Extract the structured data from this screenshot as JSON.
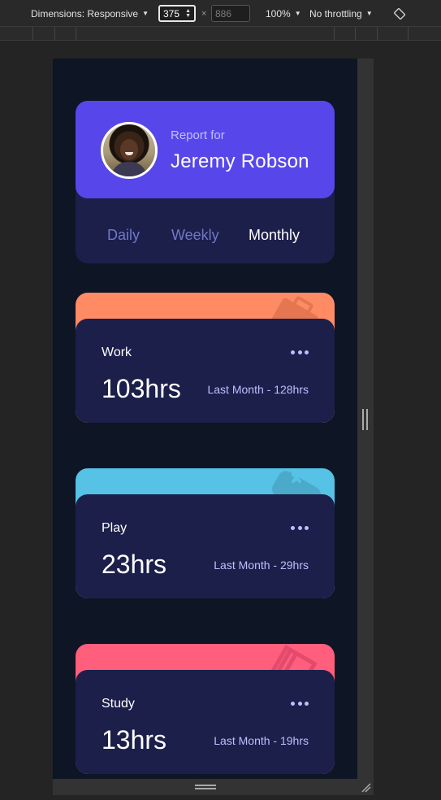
{
  "devtools": {
    "dimensions_label": "Dimensions: Responsive",
    "width_value": "375",
    "times": "×",
    "height_placeholder": "886",
    "zoom_label": "100%",
    "throttle_label": "No throttling"
  },
  "profile": {
    "report_for": "Report for",
    "name": "Jeremy Robson",
    "tabs": [
      {
        "label": "Daily",
        "active": false
      },
      {
        "label": "Weekly",
        "active": false
      },
      {
        "label": "Monthly",
        "active": true
      }
    ]
  },
  "activities": [
    {
      "title": "Work",
      "hours": "103hrs",
      "previous": "Last Month - 128hrs",
      "color": "#ff8b64",
      "icon": "work-briefcase-icon"
    },
    {
      "title": "Play",
      "hours": "23hrs",
      "previous": "Last Month - 29hrs",
      "color": "#55c2e6",
      "icon": "play-gamepad-icon"
    },
    {
      "title": "Study",
      "hours": "13hrs",
      "previous": "Last Month - 19hrs",
      "color": "#ff5e7d",
      "icon": "study-book-icon"
    }
  ],
  "colors": {
    "page_bg": "#0e1524",
    "card_bg": "#1c1f4a",
    "accent": "#5747ea",
    "muted_text": "#bbc0ff"
  }
}
